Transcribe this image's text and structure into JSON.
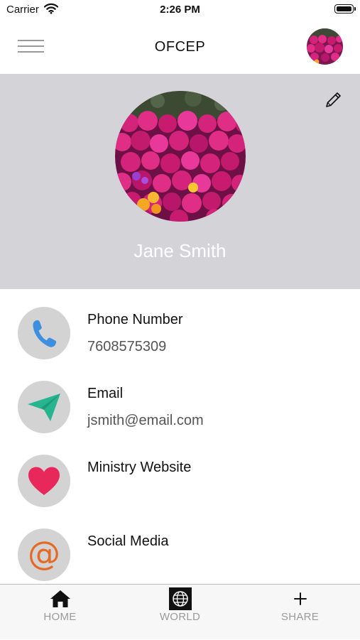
{
  "status_bar": {
    "carrier": "Carrier",
    "time": "2:26 PM"
  },
  "nav": {
    "title": "OFCEP",
    "menu_icon": "hamburger-icon"
  },
  "profile": {
    "name": "Jane Smith",
    "edit_icon": "pencil-icon"
  },
  "contacts": [
    {
      "label": "Phone Number",
      "value": "7608575309",
      "icon": "phone-icon",
      "color": "#3d8fe0"
    },
    {
      "label": "Email",
      "value": "jsmith@email.com",
      "icon": "paper-plane-icon",
      "color": "#26b58f"
    },
    {
      "label": "Ministry Website",
      "value": "",
      "icon": "heart-icon",
      "color": "#e8285a"
    },
    {
      "label": "Social Media",
      "value": "",
      "icon": "at-icon",
      "glyph": "@",
      "color": "#e46a28"
    }
  ],
  "tabs": [
    {
      "label": "HOME",
      "icon": "home-icon"
    },
    {
      "label": "WORLD",
      "icon": "globe-icon"
    },
    {
      "label": "SHARE",
      "icon": "plus-icon"
    }
  ],
  "colors": {
    "header_background": "#d3d3d8",
    "icon_circle": "#d3d3d3",
    "tab_label": "#9a9a9a"
  }
}
